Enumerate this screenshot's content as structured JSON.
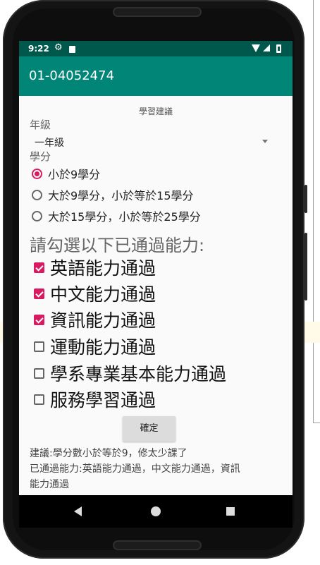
{
  "status_bar": {
    "time": "9:22"
  },
  "app_bar": {
    "title": "01-04052474"
  },
  "content": {
    "heading": "學習建議",
    "grade_label": "年級",
    "grade_value": "一年級",
    "credits_label": "學分",
    "credit_options": [
      {
        "label": "小於9學分",
        "checked": true
      },
      {
        "label": "大於9學分，小於等於15學分",
        "checked": false
      },
      {
        "label": "大於15學分，小於等於25學分",
        "checked": false
      }
    ],
    "abilities_title": "請勾選以下已通過能力:",
    "abilities": [
      {
        "label": "英語能力通過",
        "checked": true
      },
      {
        "label": "中文能力通過",
        "checked": true
      },
      {
        "label": "資訊能力通過",
        "checked": true
      },
      {
        "label": "運動能力通過",
        "checked": false
      },
      {
        "label": "學系專業基本能力通過",
        "checked": false
      },
      {
        "label": "服務學習通過",
        "checked": false
      }
    ],
    "confirm_label": "確定",
    "advice_line1": "建議:學分數小於等於9，修太少課了",
    "advice_line2": "已通過能力:英語能力通過，中文能力通過，資訊",
    "advice_line3": "能力通過"
  },
  "colors": {
    "status_bar": "#00574b",
    "app_bar": "#008577",
    "accent": "#d81b60"
  },
  "icons": [
    "gear-icon",
    "sd-card-icon",
    "wifi-icon",
    "signal-icon",
    "battery-icon",
    "dropdown-arrow-icon",
    "back-icon",
    "home-icon",
    "recents-icon"
  ]
}
